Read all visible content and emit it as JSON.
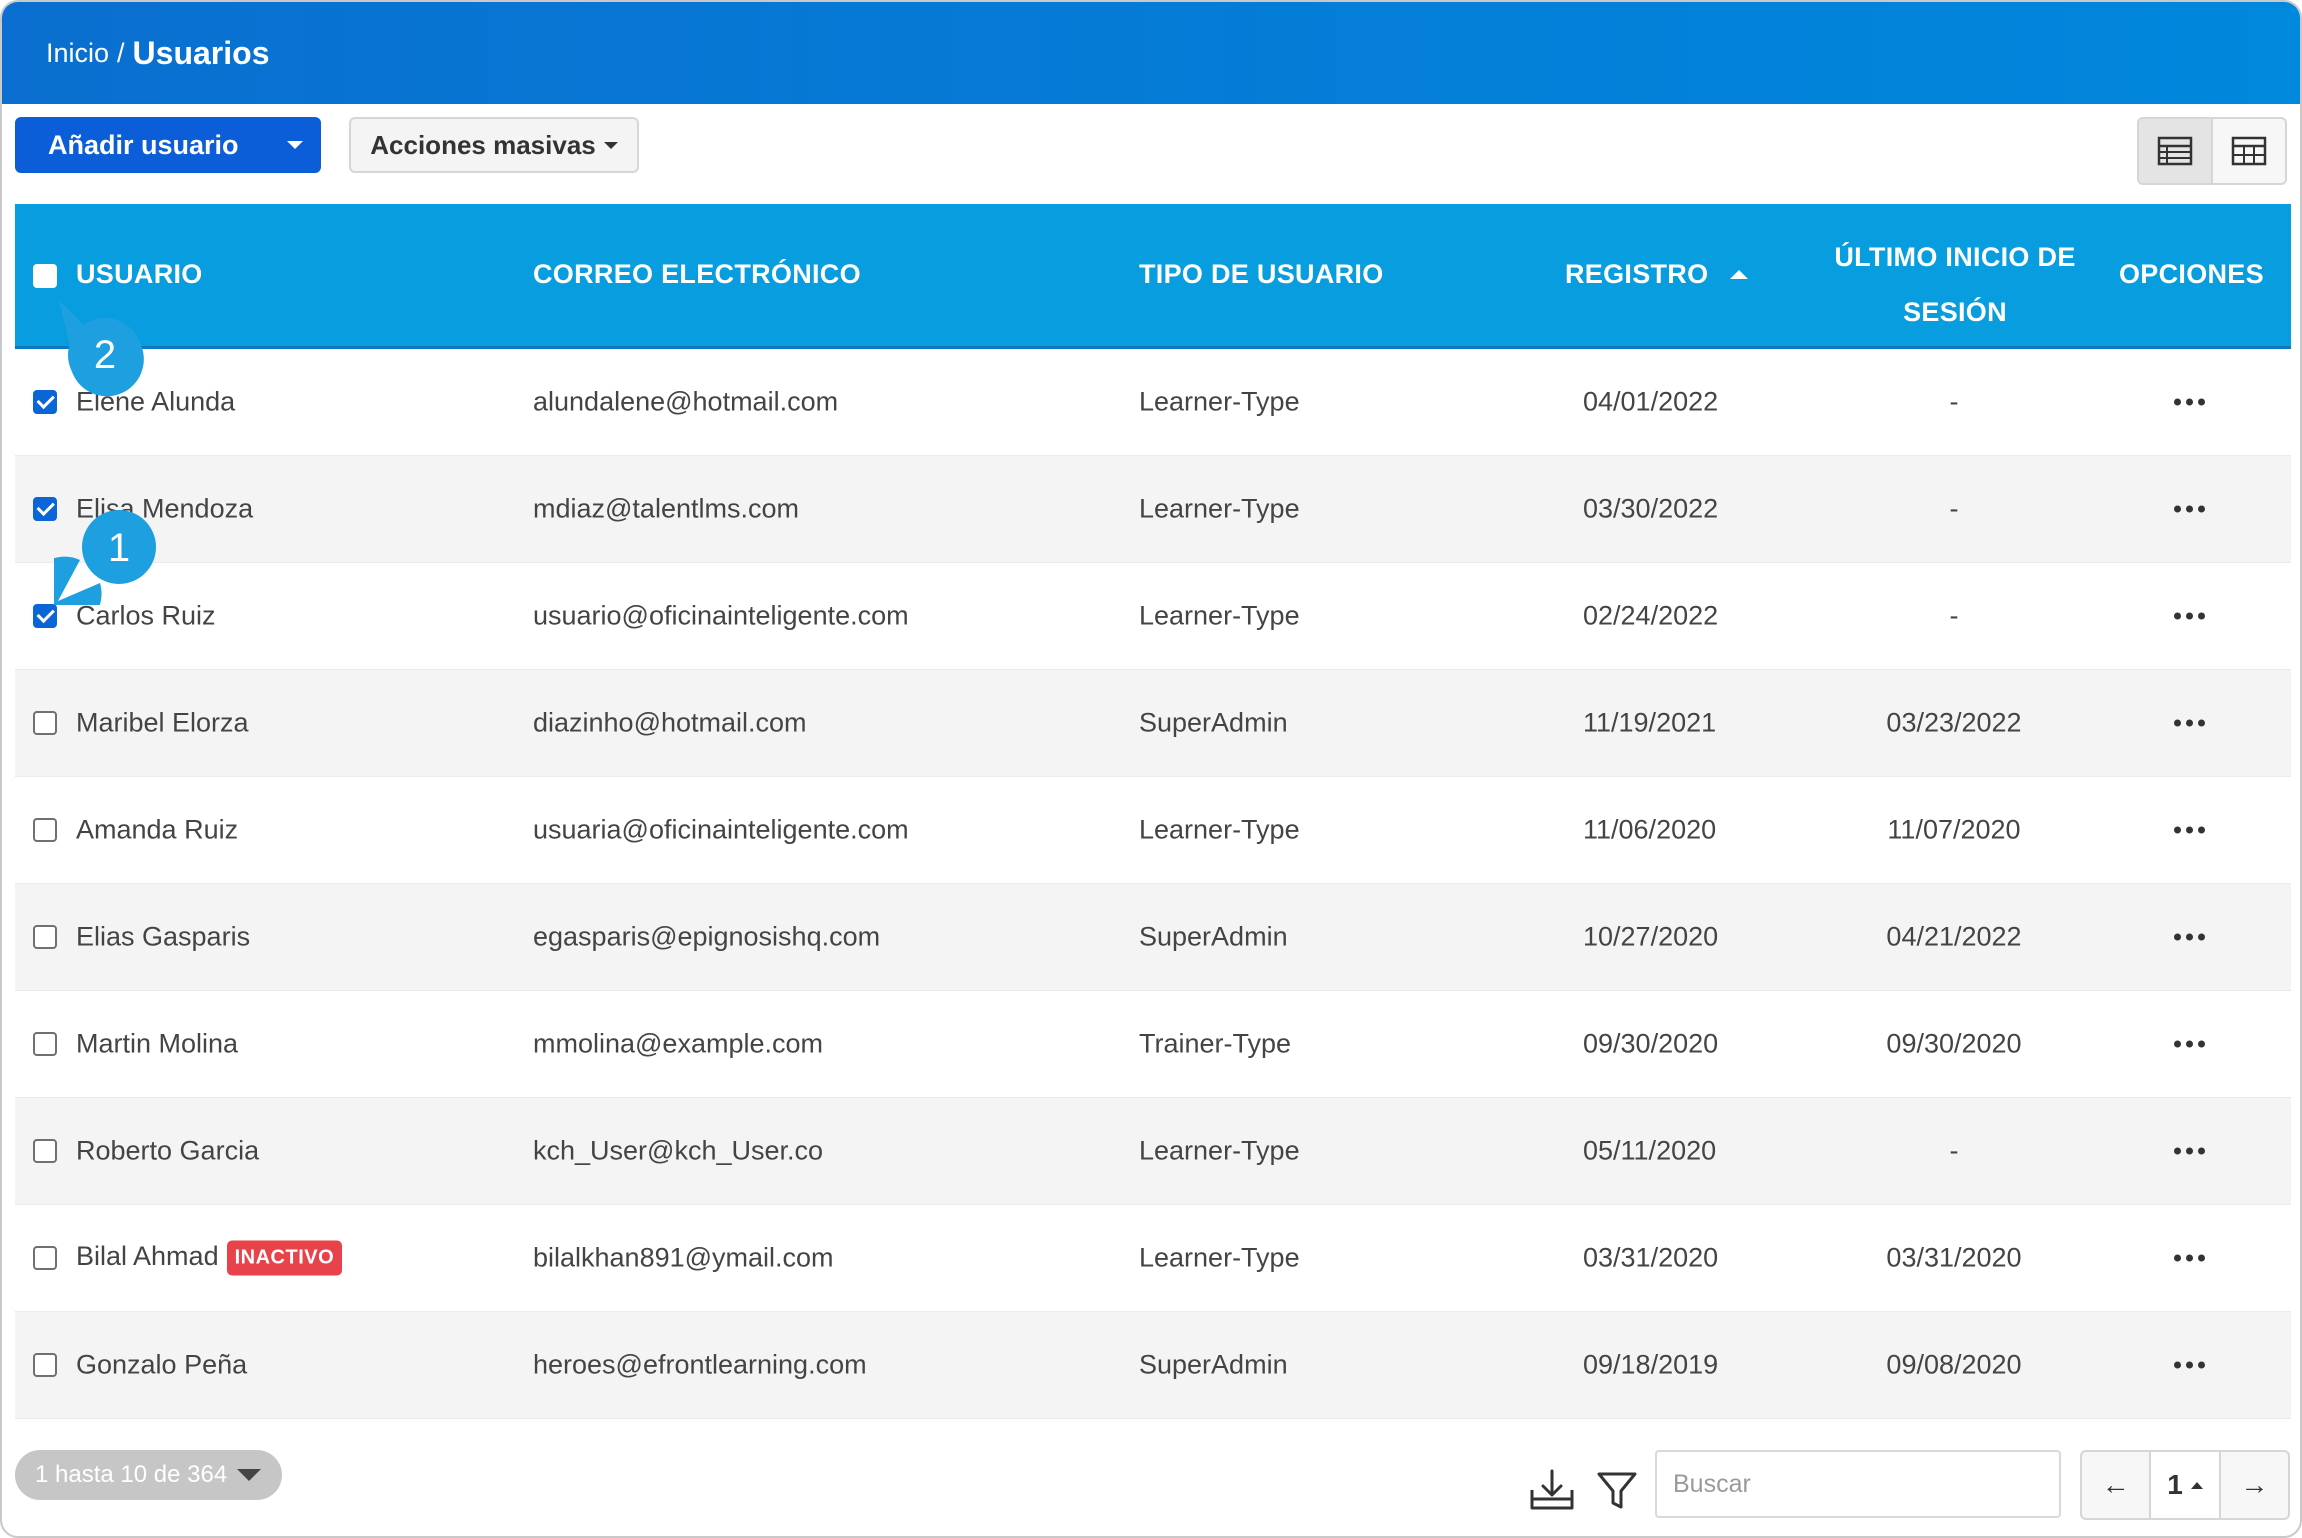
{
  "breadcrumb": {
    "home": "Inicio",
    "separator": "/",
    "current": "Usuarios"
  },
  "toolbar": {
    "add_label": "Añadir usuario",
    "bulk_label": "Acciones masivas"
  },
  "table": {
    "headers": {
      "user": "USUARIO",
      "email": "CORREO ELECTRÓNICO",
      "type": "TIPO DE USUARIO",
      "registered": "REGISTRO",
      "last_login_line1": "ÚLTIMO INICIO DE",
      "last_login_line2": "SESIÓN",
      "options": "OPCIONES"
    },
    "rows": [
      {
        "name": "Elene Alunda",
        "email": "alundalene@hotmail.com",
        "type": "Learner-Type",
        "registered": "04/01/2022",
        "last_login": "-",
        "checked": true,
        "badge": ""
      },
      {
        "name": "Elisa Mendoza",
        "email": "mdiaz@talentlms.com",
        "type": "Learner-Type",
        "registered": "03/30/2022",
        "last_login": "-",
        "checked": true,
        "badge": ""
      },
      {
        "name": "Carlos Ruiz",
        "email": "usuario@oficinainteligente.com",
        "type": "Learner-Type",
        "registered": "02/24/2022",
        "last_login": "-",
        "checked": true,
        "badge": ""
      },
      {
        "name": "Maribel Elorza",
        "email": "diazinho@hotmail.com",
        "type": "SuperAdmin",
        "registered": "11/19/2021",
        "last_login": "03/23/2022",
        "checked": false,
        "badge": ""
      },
      {
        "name": "Amanda Ruiz",
        "email": "usuaria@oficinainteligente.com",
        "type": "Learner-Type",
        "registered": "11/06/2020",
        "last_login": "11/07/2020",
        "checked": false,
        "badge": ""
      },
      {
        "name": "Elias Gasparis",
        "email": "egasparis@epignosishq.com",
        "type": "SuperAdmin",
        "registered": "10/27/2020",
        "last_login": "04/21/2022",
        "checked": false,
        "badge": ""
      },
      {
        "name": "Martin Molina",
        "email": "mmolina@example.com",
        "type": "Trainer-Type",
        "registered": "09/30/2020",
        "last_login": "09/30/2020",
        "checked": false,
        "badge": ""
      },
      {
        "name": "Roberto Garcia",
        "email": "kch_User@kch_User.co",
        "type": "Learner-Type",
        "registered": "05/11/2020",
        "last_login": "-",
        "checked": false,
        "badge": ""
      },
      {
        "name": "Bilal Ahmad",
        "email": "bilalkhan891@ymail.com",
        "type": "Learner-Type",
        "registered": "03/31/2020",
        "last_login": "03/31/2020",
        "checked": false,
        "badge": "INACTIVO"
      },
      {
        "name": "Gonzalo Peña",
        "email": "heroes@efrontlearning.com",
        "type": "SuperAdmin",
        "registered": "09/18/2019",
        "last_login": "09/08/2020",
        "checked": false,
        "badge": ""
      }
    ]
  },
  "callouts": {
    "one": "1",
    "two": "2"
  },
  "footer": {
    "range": "1 hasta 10 de 364",
    "search_placeholder": "Buscar",
    "page": "1",
    "prev": "←",
    "next": "→"
  },
  "colors": {
    "header": "#0088dd",
    "table_header": "#089dde",
    "primary_button": "#0b5ed7",
    "badge": "#e8434a",
    "callout": "#1e9fe0"
  }
}
